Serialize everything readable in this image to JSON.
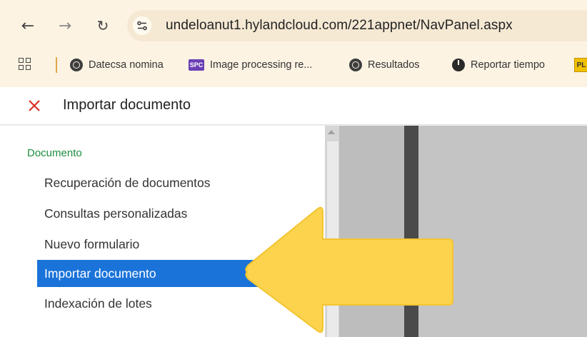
{
  "browser": {
    "url": "undeloanut1.hylandcloud.com/221appnet/NavPanel.aspx",
    "bookmarks": [
      {
        "label": "Datecsa nomina",
        "icon": "globe-icon"
      },
      {
        "label": "Image processing re...",
        "icon": "spc-logo-icon"
      },
      {
        "label": "Resultados",
        "icon": "globe-icon"
      },
      {
        "label": "Reportar tiempo",
        "icon": "timer-icon"
      }
    ],
    "spc_logo_text": "SPC",
    "pl_logo_text": "PL"
  },
  "header": {
    "title": "Importar documento"
  },
  "nav": {
    "section": "Documento",
    "items": [
      {
        "label": "Recuperación de documentos",
        "selected": false
      },
      {
        "label": "Consultas personalizadas",
        "selected": false
      },
      {
        "label": "Nuevo formulario",
        "selected": false
      },
      {
        "label": "Importar documento",
        "selected": true
      },
      {
        "label": "Indexación de lotes",
        "selected": false
      }
    ]
  },
  "colors": {
    "accent_selected": "#1a73d9",
    "section_header": "#1e8e3e",
    "close_icon": "#d93025",
    "annotation_arrow": "#fcd34d"
  }
}
